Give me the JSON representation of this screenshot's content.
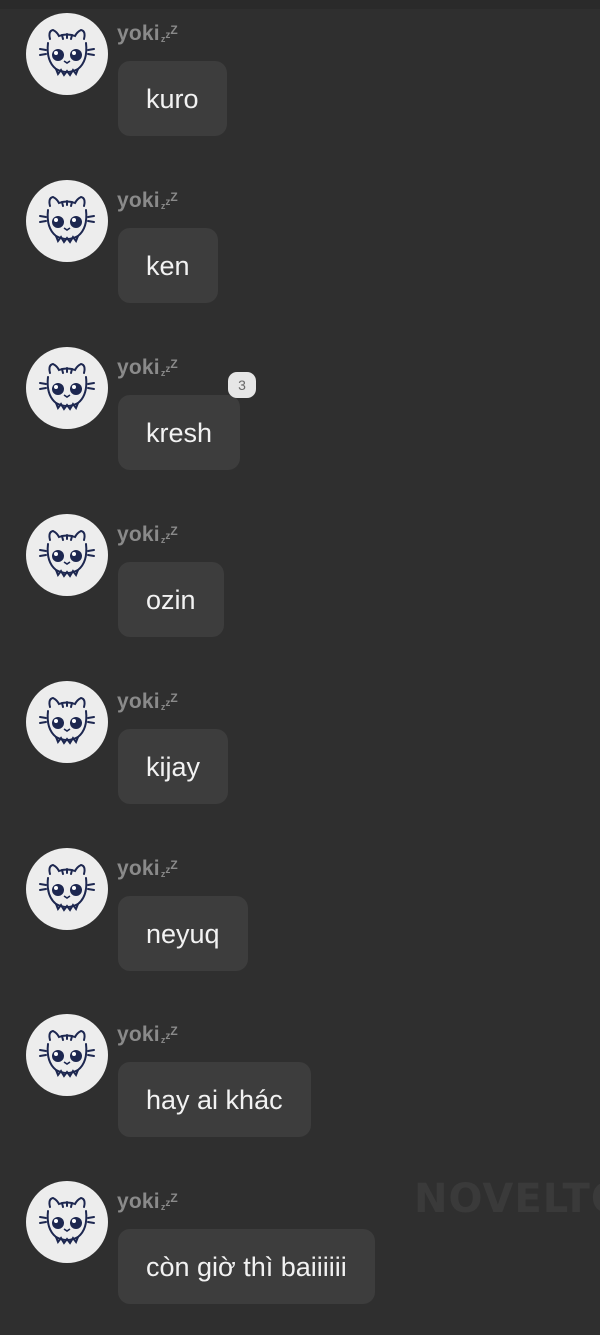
{
  "sender": {
    "name": "yoki",
    "status_suffix": "zzZ"
  },
  "messages": [
    {
      "text": "kuro"
    },
    {
      "text": "ken"
    },
    {
      "text": "kresh",
      "reaction_count": "3"
    },
    {
      "text": "ozin"
    },
    {
      "text": "kijay"
    },
    {
      "text": "neyuq"
    },
    {
      "text": "hay ai khác"
    },
    {
      "text": "còn giờ thì baiiiiii"
    }
  ],
  "watermark": "NOVELTO",
  "colors": {
    "background": "#2f2f2f",
    "bubble": "#3d3d3d",
    "bubble_text": "#f2f2f2",
    "sender_name": "#8a8a8a",
    "avatar_bg": "#ededed",
    "avatar_ink": "#1d2750"
  },
  "icons": {
    "avatar": "cat-face-avatar",
    "sleep": "zzz-sleep-icon"
  }
}
